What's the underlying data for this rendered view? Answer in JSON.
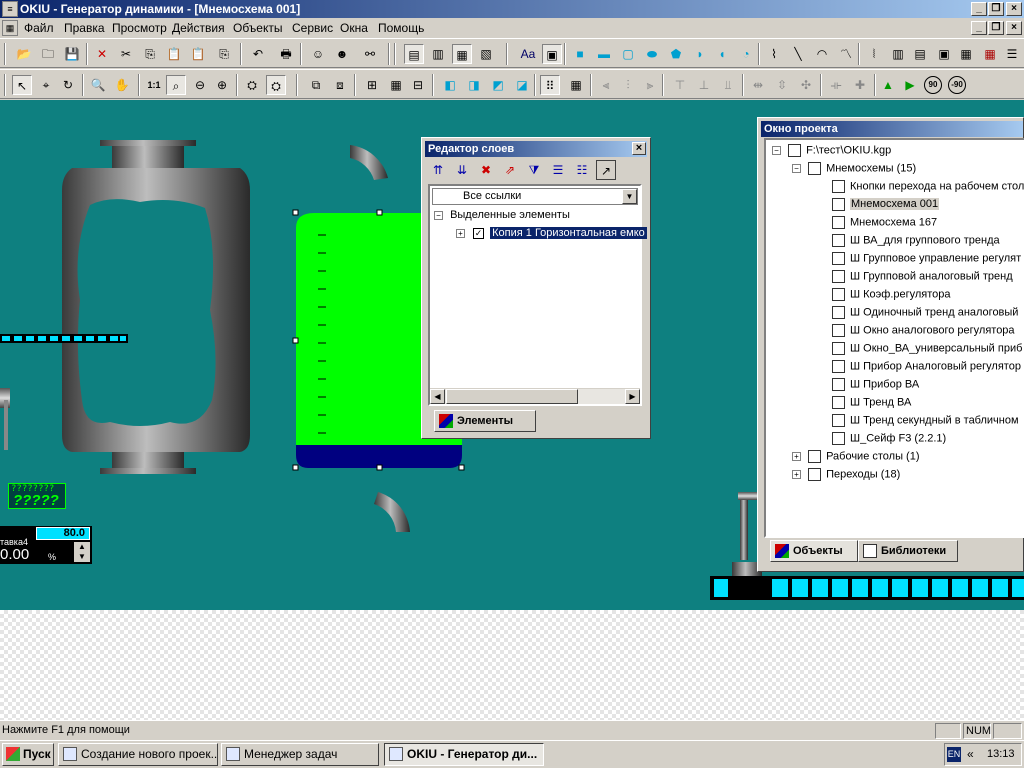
{
  "window": {
    "title": "OKIU - Генератор динамики - [Мнемосхема 001]",
    "app_icon": "app-icon"
  },
  "menu": [
    "Файл",
    "Правка",
    "Просмотр",
    "Действия",
    "Объекты",
    "Сервис",
    "Окна",
    "Помощь"
  ],
  "toolbar1": [
    "open-icon",
    "folder-icon",
    "save-icon",
    "delete-icon",
    "cut-icon",
    "copy-icon",
    "paste-icon",
    "paste-special-icon",
    "paste-icon",
    "undo-icon",
    "print-icon",
    "wizard-icon",
    "wizard2-icon",
    "binoculars-icon",
    "layers-icon",
    "layers2-icon",
    "layers3-icon",
    "layers4-icon",
    "text-icon",
    "image-icon",
    "rect-icon",
    "rect2-icon",
    "rounded-rect-icon",
    "ellipse-icon",
    "polygon-icon",
    "shape-icon",
    "shape2-icon",
    "arc-icon",
    "line-icon",
    "line2-icon",
    "curve-icon",
    "polyline-icon",
    "trend-icon",
    "chart-icon",
    "gauge-icon",
    "window-icon",
    "grid-icon",
    "table-icon",
    "list-icon"
  ],
  "toolbar2": [
    "select-icon",
    "node-edit-icon",
    "rotate-icon",
    "zoom-icon",
    "hand-icon",
    "zoom-1-1-icon",
    "zoom-fit-icon",
    "zoom-out-icon",
    "zoom-in-icon",
    "props-icon",
    "props2-icon",
    "group-icon",
    "ungroup-icon",
    "grid-snap-icon",
    "grid2-icon",
    "grid3-icon",
    "front-icon",
    "back-icon",
    "forward-icon",
    "backward-icon",
    "snap-icon",
    "align-grid-icon",
    "align-left-icon",
    "align-center-icon",
    "align-right-icon",
    "align-top-icon",
    "align-middle-icon",
    "align-bottom-icon",
    "space-h-icon",
    "space-v-icon",
    "same-w-icon",
    "same-h-icon",
    "flip-h-icon",
    "flip-v-icon",
    "rotate-90-icon",
    "rotate-m90-icon"
  ],
  "toolbar2_labels": {
    "zoom11": "1:1",
    "rot90": "90",
    "rotm90": "-90"
  },
  "canvas": {
    "unknown_label_top": "????????",
    "unknown_label_bottom": "?????",
    "setpoint_value": "80.0",
    "setpoint_label": "тавка4",
    "setpoint_big": "0.00",
    "setpoint_unit": "%"
  },
  "layers_panel": {
    "title": "Редактор слоев",
    "close": "×",
    "toolbar_icons": [
      "layer-up-icon",
      "layer-down-icon",
      "layer-delete-icon",
      "layer-link-icon",
      "layer-filter-icon",
      "layer-list-icon",
      "layer-list2-icon",
      "layer-go-icon"
    ],
    "dropdown_value": "Все ссылки",
    "group_label": "Выделенные элементы",
    "item_label": "Копия 1 Горизонтальная емко",
    "item_checked": true,
    "tab_label": "Элементы"
  },
  "project_panel": {
    "title": "Окно проекта",
    "root": "F:\\тест\\OKIU.kgp",
    "groups": [
      {
        "label": "Мнемосхемы (15)",
        "expanded": true
      },
      {
        "label": "Рабочие столы (1)",
        "expanded": false
      },
      {
        "label": "Переходы (18)",
        "expanded": false
      }
    ],
    "items": [
      "Кнопки перехода на рабочем стол",
      "Мнемосхема 001",
      "Мнемосхема 167",
      "Ш ВА_для группового тренда",
      "Ш Групповое управление регулят",
      "Ш Групповой аналоговый тренд",
      "Ш Коэф.регулятора",
      "Ш Одиночный тренд аналоговый",
      "Ш Окно аналогового регулятора",
      "Ш Окно_ВА_универсальный приб",
      "Ш Прибор Аналоговый регулятор",
      "Ш Прибор ВА",
      "Ш Тренд ВА",
      "Ш Тренд секундный в табличном",
      "Ш_Сейф F3 (2.2.1)"
    ],
    "selected_item": "Мнемосхема 001",
    "tabs": [
      "Объекты",
      "Библиотеки"
    ]
  },
  "status": {
    "help": "Нажмите  F1 для помощи",
    "num": "NUM"
  },
  "taskbar": {
    "start": "Пуск",
    "tasks": [
      "Создание нового проек...",
      "Менеджер задач",
      "OKIU - Генератор ди..."
    ],
    "lang": "EN",
    "chevron": "«",
    "time": "13:13"
  },
  "colors": {
    "canvas_bg": "#0e8080",
    "tank_fill": "#00ff00",
    "tank_bottom": "#000080",
    "title_bar": "#0a246a"
  }
}
